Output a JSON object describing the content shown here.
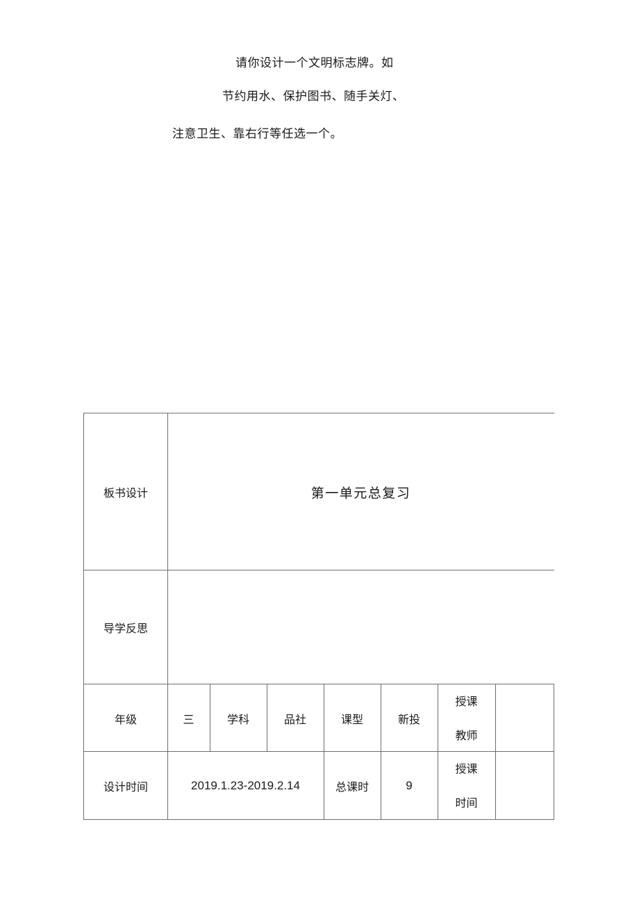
{
  "instructions": {
    "lines": [
      "请你设计一个文明标志牌。如",
      "节约用水、保护图书、随手关灯、",
      "注意卫生、靠右行等任选一个。"
    ]
  },
  "table": {
    "board_design": {
      "label": "板书设计",
      "content": "第一单元总复习"
    },
    "reflection": {
      "label": "导学反思",
      "content": ""
    },
    "info_row": {
      "grade_label": "年级",
      "grade_value": "三",
      "subject_label": "学科",
      "subject_value": "品社",
      "lesson_type_label": "课型",
      "lesson_type_value": "新投",
      "teacher_label_line1": "授课",
      "teacher_label_line2": "教师",
      "teacher_value": ""
    },
    "time_row": {
      "design_time_label": "设计时间",
      "design_time_value": "2019.1.23-2019.2.14",
      "total_hours_label": "总课时",
      "total_hours_value": "9",
      "class_time_label_line1": "授课",
      "class_time_label_line2": "时间",
      "class_time_value": ""
    }
  }
}
